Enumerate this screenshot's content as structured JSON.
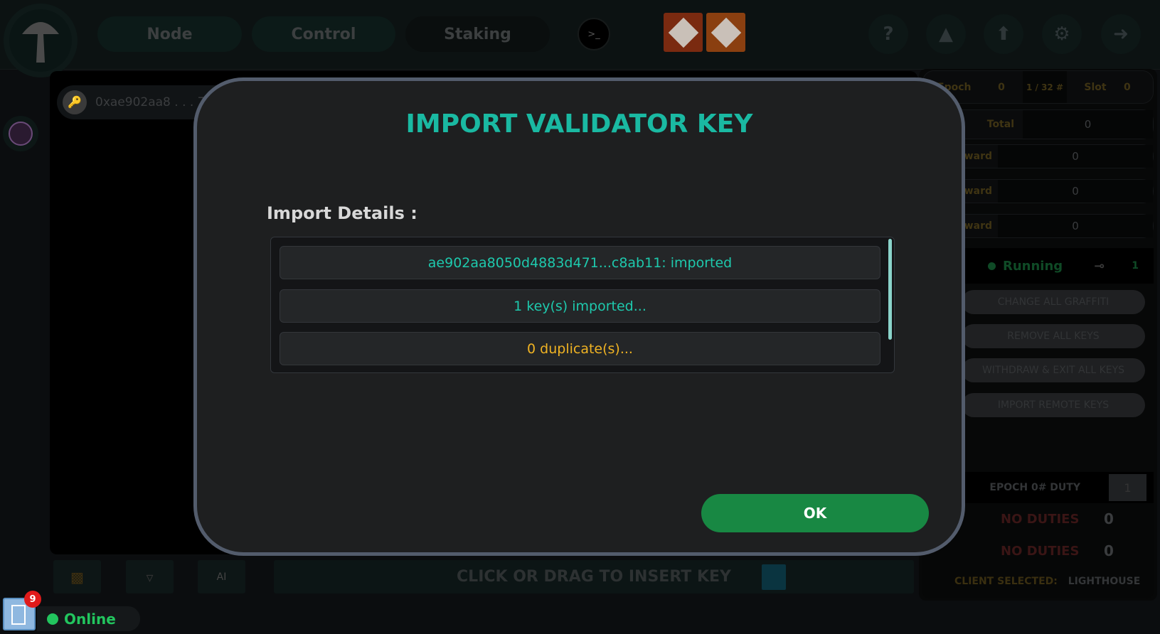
{
  "nav": {
    "tabs": [
      "Node",
      "Control",
      "Staking"
    ],
    "terminal_icon": "terminal-icon",
    "apps": [
      "prometheus-icon",
      "grafana-icon"
    ],
    "right_icons": [
      "help-icon",
      "megaphone-icon",
      "upload-arrow-icon",
      "gear-icon",
      "logout-icon"
    ],
    "help_glyph": "?"
  },
  "key_list": {
    "first_key": "0xae902aa8 . . . 75"
  },
  "stats": {
    "epoch_label": "Epoch",
    "epoch_value": "0",
    "slot_progress": "1 / 32 #",
    "slot_label": "Slot",
    "slot_value": "0",
    "total_label": "Total",
    "total_value": "0",
    "reward_rows": [
      {
        "label": "Reward",
        "value": "0"
      },
      {
        "label": "Reward",
        "value": "0"
      },
      {
        "label": "Reward",
        "value": "0"
      }
    ]
  },
  "validator": {
    "status": "Running",
    "key_count": "1",
    "status_color": "#1e8a4a"
  },
  "actions": [
    "CHANGE ALL GRAFFITI",
    "REMOVE ALL KEYS",
    "WITHDRAW & EXIT ALL KEYS",
    "IMPORT REMOTE KEYS"
  ],
  "duty": {
    "title": "EPOCH 0# DUTY",
    "epoch_input": "1",
    "rows": [
      {
        "label": "NO DUTIES",
        "value": "0"
      },
      {
        "label": "NO DUTIES",
        "value": "0"
      }
    ],
    "client_label": "CLIENT SELECTED:",
    "client_value": "LIGHTHOUSE"
  },
  "bottom": {
    "insert_label": "CLICK OR DRAG TO INSERT KEY",
    "ai_label": "AI"
  },
  "status": {
    "badge_count": "9",
    "online": "Online"
  },
  "modal": {
    "title": "IMPORT VALIDATOR KEY",
    "details_label": "Import Details :",
    "items": [
      {
        "text": "ae902aa8050d4883d471...c8ab11:  imported",
        "color": "#1ec9ad"
      },
      {
        "text": "1 key(s) imported...",
        "color": "#1ec9ad"
      },
      {
        "text": "0 duplicate(s)...",
        "color": "#f0b323"
      }
    ],
    "ok": "OK",
    "accent": "#1ab9a2",
    "ok_color": "#188843"
  }
}
